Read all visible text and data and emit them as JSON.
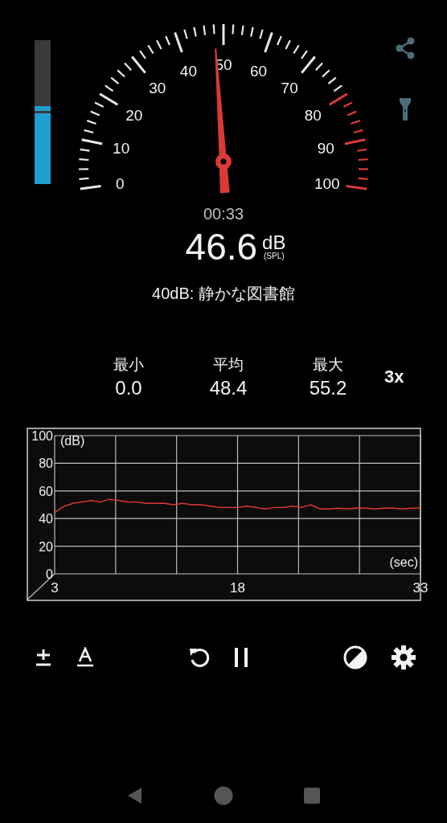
{
  "level_bar": {
    "level": 0.54
  },
  "gauge": {
    "scale_labels": [
      "0",
      "10",
      "20",
      "30",
      "40",
      "50",
      "60",
      "70",
      "80",
      "90",
      "100"
    ]
  },
  "timer": "00:33",
  "reading": {
    "value": "46.6",
    "unit": "dB",
    "unit_note": "(SPL)"
  },
  "description": "40dB: 静かな図書館",
  "stats": [
    {
      "label": "最小",
      "value": "0.0"
    },
    {
      "label": "平均",
      "value": "48.4"
    },
    {
      "label": "最大",
      "value": "55.2"
    }
  ],
  "zoom_button": "3x",
  "history": {
    "chart_data": {
      "type": "line",
      "xlabel": "(sec)",
      "ylabel": "(dB)",
      "xlim": [
        3,
        33
      ],
      "ylim": [
        0,
        100
      ],
      "xticks": [
        3,
        18,
        33
      ],
      "yticks": [
        0,
        20,
        40,
        60,
        80,
        100
      ],
      "grid": true,
      "x": [
        3,
        3.75,
        4.5,
        5.25,
        6,
        6.75,
        7.5,
        8.25,
        9,
        9.75,
        10.5,
        11.25,
        12,
        12.75,
        13.5,
        14.25,
        15,
        15.75,
        16.5,
        17.25,
        18,
        18.75,
        19.5,
        20.25,
        21,
        21.75,
        22.5,
        23.25,
        24,
        24.75,
        25.5,
        26.25,
        27,
        27.75,
        28.5,
        29.25,
        30,
        30.75,
        31.5,
        32.25,
        33
      ],
      "series": [
        {
          "color": "#e53935",
          "values": [
            44.4,
            48.8,
            51,
            52,
            53,
            52,
            54,
            53,
            52,
            52,
            51,
            51,
            51,
            50,
            51,
            50,
            50,
            49,
            48,
            48,
            48,
            49,
            48,
            47,
            48,
            48,
            49,
            48,
            50,
            47,
            47,
            47.5,
            47,
            47.5,
            47.5,
            47,
            47.5,
            47.5,
            47,
            47.5,
            47.5
          ]
        }
      ]
    }
  }
}
